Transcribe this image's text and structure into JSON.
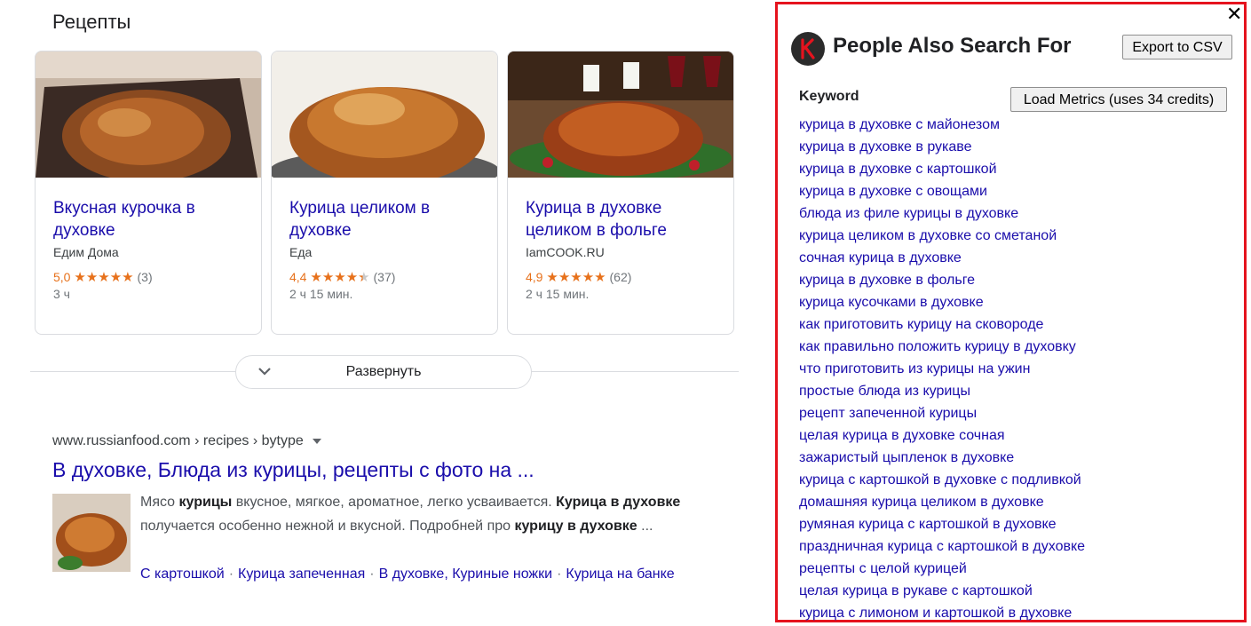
{
  "recipes": {
    "heading": "Рецепты",
    "cards": [
      {
        "title": "Вкусная курочка в духовке",
        "source": "Едим Дома",
        "rating": "5,0",
        "stars": "★★★★★",
        "count": "(3)",
        "time": "3 ч",
        "stars_value": 5.0
      },
      {
        "title": "Курица целиком в духовке",
        "source": "Еда",
        "rating": "4,4",
        "stars": "★★★★★",
        "count": "(37)",
        "time": "2 ч 15 мин.",
        "stars_value": 4.4
      },
      {
        "title": "Курица в духовке целиком в фольге",
        "source": "IamCOOK.RU",
        "rating": "4,9",
        "stars": "★★★★★",
        "count": "(62)",
        "time": "2 ч 15 мин.",
        "stars_value": 4.9
      }
    ],
    "expand_label": "Развернуть"
  },
  "result": {
    "cite": "www.russianfood.com › recipes › bytype",
    "title": "В духовке, Блюда из курицы, рецепты с фото на ...",
    "snippet": [
      {
        "t": "Мясо ",
        "b": false
      },
      {
        "t": "курицы",
        "b": true
      },
      {
        "t": " вкусное, мягкое, ароматное, легко усваивается. ",
        "b": false
      },
      {
        "t": "Курица в духовке",
        "b": true
      },
      {
        "t": " получается особенно нежной и вкусной. Подробней про ",
        "b": false
      },
      {
        "t": "курицу в духовке",
        "b": true
      },
      {
        "t": " ...",
        "b": false
      }
    ],
    "sublinks": [
      "С картошкой",
      "Курица запеченная",
      "В духовке, Куриные ножки",
      "Курица на банке"
    ],
    "separator": "·"
  },
  "panel": {
    "close": "✕",
    "logo_letter": "K",
    "title": "People Also Search For",
    "export_label": "Export to CSV",
    "keyword_header": "Keyword",
    "load_label": "Load Metrics (uses 34 credits)",
    "keywords": [
      "курица в духовке с майонезом",
      "курица в духовке в рукаве",
      "курица в духовке с картошкой",
      "курица в духовке с овощами",
      "блюда из филе курицы в духовке",
      "курица целиком в духовке со сметаной",
      "сочная курица в духовке",
      "курица в духовке в фольге",
      "курица кусочками в духовке",
      "как приготовить курицу на сковороде",
      "как правильно положить курицу в духовку",
      "что приготовить из курицы на ужин",
      "простые блюда из курицы",
      "рецепт запеченной курицы",
      "целая курица в духовке сочная",
      "зажаристый цыпленок в духовке",
      "курица с картошкой в духовке с подливкой",
      "домашняя курица целиком в духовке",
      "румяная курица с картошкой в духовке",
      "праздничная курица с картошкой в духовке",
      "рецепты с целой курицей",
      "целая курица в рукаве с картошкой",
      "курица с лимоном и картошкой в духовке"
    ],
    "accent_color": "#e5131e"
  }
}
